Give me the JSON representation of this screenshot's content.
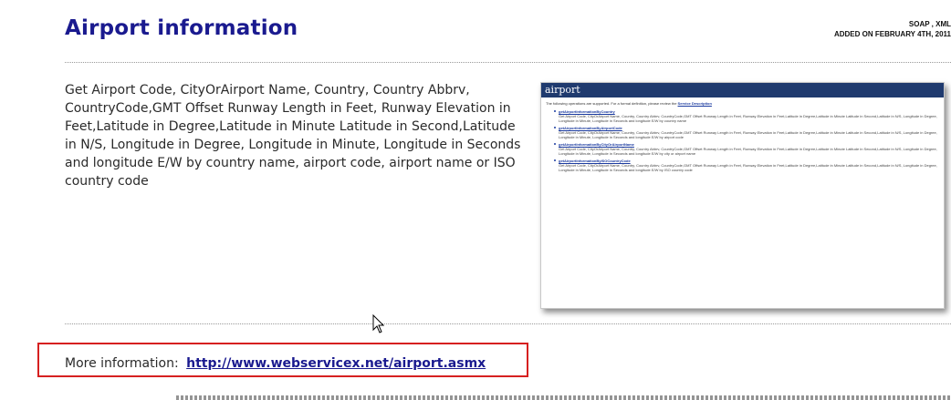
{
  "header": {
    "title": "Airport information",
    "tags": "SOAP , XML",
    "added": "ADDED ON FEBRUARY 4TH, 2011"
  },
  "description": "Get Airport Code, CityOrAirport Name, Country, Country Abbrv, CountryCode,GMT Offset Runway Length in Feet, Runway Elevation in Feet,Latitude in Degree,Latitude in Minute Latitude in Second,Latitude in N/S, Longitude in Degree, Longitude in Minute, Longitude in Seconds and longitude E/W by country name, airport code, airport name or ISO country code",
  "thumbnail": {
    "header": "airport",
    "intro": "The following operations are supported. For a formal definition, please review the",
    "intro_link": "Service Description",
    "operations": [
      {
        "name": "getAirportInformationByCountry",
        "desc": "Get Airport Code, CityOrAirport Name, Country, Country Abbrv, CountryCode,GMT Offset Runway Length in Feet, Runway Elevation in Feet,Latitude in Degree,Latitude in Minute Latitude in Second,Latitude in N/S, Longitude in Degree, Longitude in Minute, Longitude in Seconds and longitude E/W by country name"
      },
      {
        "name": "getAirportInformationByAirportCode",
        "desc": "Get Airport Code, CityOrAirport Name, Country, Country Abbrv, CountryCode,GMT Offset Runway Length in Feet, Runway Elevation in Feet,Latitude in Degree,Latitude in Minute Latitude in Second,Latitude in N/S, Longitude in Degree, Longitude in Minute, Longitude in Seconds and longitude E/W by airport code"
      },
      {
        "name": "getAirportInformationByCityOrAirportName",
        "desc": "Get Airport Code, CityOrAirport Name, Country, Country Abbrv, CountryCode,GMT Offset Runway Length in Feet, Runway Elevation in Feet,Latitude in Degree,Latitude in Minute Latitude in Second,Latitude in N/S, Longitude in Degree, Longitude in Minute, Longitude in Seconds and longitude E/W by city or airport name"
      },
      {
        "name": "getAirportInformationByISOCountryCode",
        "desc": "Get Airport Code, CityOrAirport Name, Country, Country Abbrv, CountryCode,GMT Offset Runway Length in Feet, Runway Elevation in Feet,Latitude in Degree,Latitude in Minute Latitude in Second,Latitude in N/S, Longitude in Degree, Longitude in Minute, Longitude in Seconds and longitude E/W by ISO country code"
      }
    ]
  },
  "more_info": {
    "label": "More information:",
    "url": "http://www.webservicex.net/airport.asmx"
  },
  "colors": {
    "title": "#1a1a8f",
    "link": "#1a1a8f",
    "highlight": "#d62020",
    "thumb_header": "#1f3a6e"
  }
}
